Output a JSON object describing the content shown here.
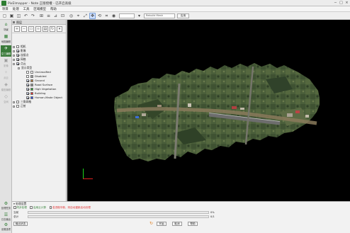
{
  "app": {
    "title": "PixElmapper - Note 正版授權 - 已开启高级"
  },
  "window_controls": {
    "minimize": "−",
    "maximize": "□",
    "close": "×"
  },
  "menu": [
    "项目",
    "处理",
    "工具",
    "区域模型",
    "帮助"
  ],
  "toolbar": {
    "combo1": "",
    "combo2": "Rebuild Mesh",
    "apply_label": "应用",
    "caption": "颜色渲染"
  },
  "left_nav": [
    {
      "label": "场景",
      "icon": "home-icon"
    },
    {
      "label": "地图编辑",
      "icon": "map-edit-icon"
    },
    {
      "label": "空三编辑",
      "icon": "aerial-edit-icon"
    },
    {
      "label": "影像",
      "icon": "photo-icon"
    },
    {
      "label": "点云",
      "icon": "point-cloud-icon"
    },
    {
      "label": "模型编辑",
      "icon": "model-edit-icon"
    },
    {
      "label": "空间",
      "icon": "space-icon"
    }
  ],
  "bottom_nav": [
    {
      "label": "处理任务",
      "icon": "task-icon"
    },
    {
      "label": "日志输出",
      "icon": "log-icon"
    },
    {
      "label": "设置选项",
      "icon": "settings-icon"
    }
  ],
  "panel": {
    "title": "图层",
    "tree": [
      {
        "level": 0,
        "exp": "+",
        "checked": false,
        "label": "相机"
      },
      {
        "level": 0,
        "exp": "+",
        "checked": true,
        "label": "影像"
      },
      {
        "level": 0,
        "exp": "+",
        "checked": true,
        "label": "连接点"
      },
      {
        "level": 0,
        "exp": "+",
        "checked": true,
        "label": "网格"
      },
      {
        "level": 0,
        "exp": "-",
        "checked": true,
        "label": "点云"
      },
      {
        "level": 1,
        "exp": "-",
        "checked": null,
        "label": "显示类型"
      },
      {
        "level": 2,
        "exp": "",
        "checked": false,
        "label": "Unclassified",
        "color": "#ffffff"
      },
      {
        "level": 2,
        "exp": "",
        "checked": false,
        "label": "Disabled",
        "color": "#9e9e9e"
      },
      {
        "level": 2,
        "exp": "",
        "checked": true,
        "label": "Ground",
        "color": "#b37a3c"
      },
      {
        "level": 2,
        "exp": "",
        "checked": true,
        "label": "Road Surface",
        "color": "#8f8f8f"
      },
      {
        "level": 2,
        "exp": "",
        "checked": true,
        "label": "High Vegetation",
        "color": "#2e9d2e"
      },
      {
        "level": 2,
        "exp": "",
        "checked": true,
        "label": "Building",
        "color": "#e03030"
      },
      {
        "level": 2,
        "exp": "",
        "checked": true,
        "label": "Human-Made Object",
        "color": "#3050e0"
      },
      {
        "level": 0,
        "exp": "+",
        "checked": false,
        "label": "三角网格"
      },
      {
        "level": 0,
        "exp": "+",
        "checked": false,
        "label": "正射"
      }
    ]
  },
  "bottom": {
    "heading": "处理设置",
    "options": [
      "同步处理",
      "启用云计算",
      "若进程中断，则自动重新启动处理"
    ],
    "step_label": "当前",
    "total_label": "总计",
    "step_value": "0%",
    "step_progress": 0,
    "total_value": "0/1",
    "total_progress": 0,
    "export_label": "输出状态",
    "start": "开始",
    "cancel": "取消",
    "help": "帮助"
  },
  "colors": {
    "accent": "#2e7d32",
    "viewport": "#000000",
    "axis_y": "#1bd61b",
    "axis_x": "#e02020",
    "warning": "#e03030"
  }
}
